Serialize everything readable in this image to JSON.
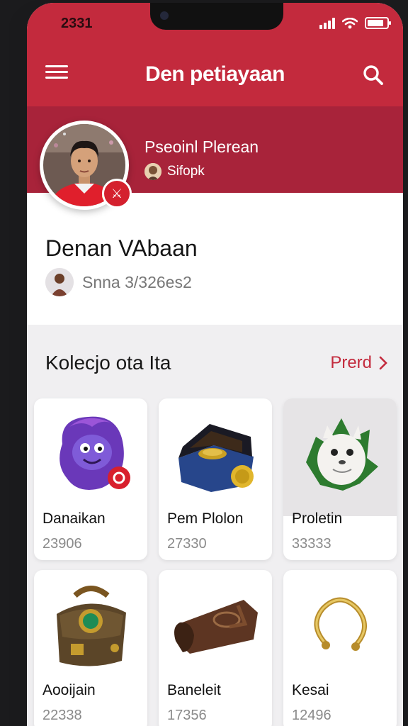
{
  "status_bar": {
    "time": "2331"
  },
  "app_bar": {
    "title": "Den petiayaan",
    "menu_icon": "hamburger-menu-icon",
    "search_icon": "search-icon"
  },
  "profile": {
    "subtitle": "Pseoinl Plerean",
    "handle": "Sifopk",
    "display_name": "Denan VAbaan",
    "meta": "Snna 3/326es2",
    "accent": "#c32a3d"
  },
  "collection": {
    "title": "Kolecjo ota Ita",
    "see_all": "Prerd",
    "items": [
      {
        "name": "Danaikan",
        "code": "23906",
        "icon": "purple-creature-icon"
      },
      {
        "name": "Pem Plolon",
        "code": "27330",
        "icon": "treasure-box-icon"
      },
      {
        "name": "Proletin",
        "code": "33333",
        "icon": "white-wolf-icon"
      },
      {
        "name": "Aooijain",
        "code": "22338",
        "icon": "satchel-icon"
      },
      {
        "name": "Baneleit",
        "code": "17356",
        "icon": "leather-wallet-icon"
      },
      {
        "name": "Kesai",
        "code": "12496",
        "icon": "gold-ring-icon"
      }
    ]
  }
}
